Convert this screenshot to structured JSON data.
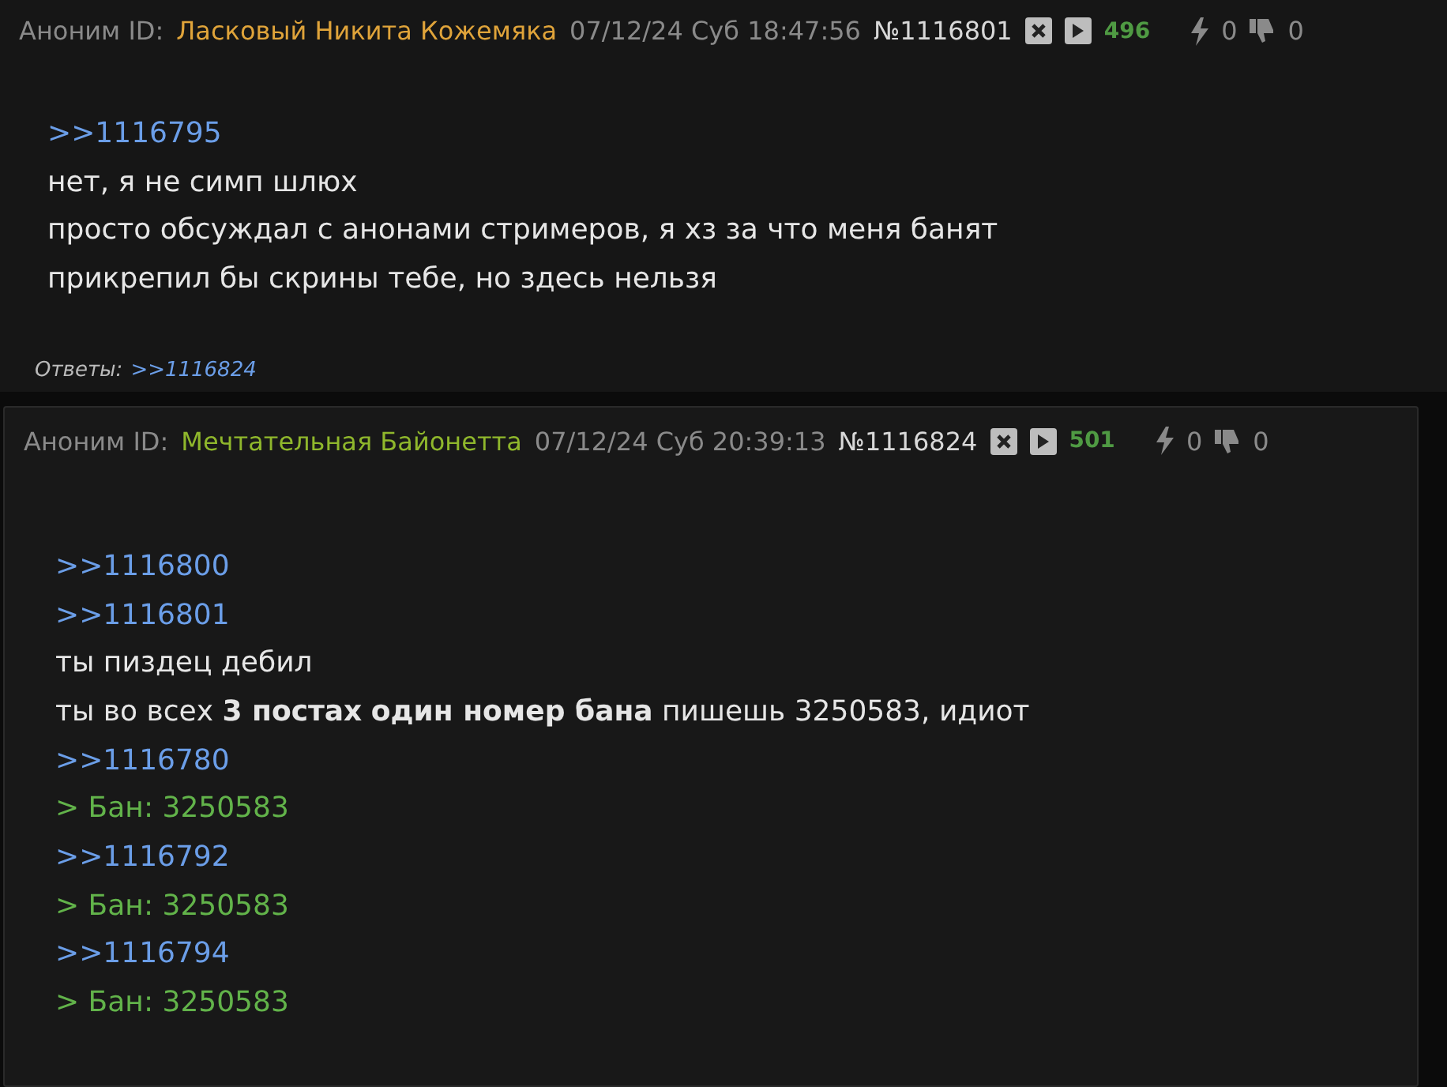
{
  "posts": [
    {
      "author": "Аноним ID:",
      "name": "Ласковый Никита Кожемяка",
      "color": "#e0a43a",
      "date": "07/12/24 Суб 18:47:56",
      "number": "№1116801",
      "count": "496",
      "likes": "0",
      "dislikes": "0",
      "lines": [
        {
          "kind": "reply-link",
          "text": ">>1116795"
        },
        {
          "kind": "text",
          "text": "нет, я не симп шлюх"
        },
        {
          "kind": "text",
          "text": "просто обсуждал с анонами стримеров, я хз за что меня банят"
        },
        {
          "kind": "text",
          "text": "прикрепил бы скрины тебе, но здесь нельзя"
        }
      ],
      "replies_label": "Ответы:",
      "replies": [
        ">>1116824"
      ]
    },
    {
      "author": "Аноним ID:",
      "name": "Мечтательная Байонетта",
      "color": "#8fb72c",
      "date": "07/12/24 Суб 20:39:13",
      "number": "№1116824",
      "count": "501",
      "likes": "0",
      "dislikes": "0",
      "lines": [
        {
          "kind": "reply-link",
          "text": ">>1116800"
        },
        {
          "kind": "reply-link",
          "text": ">>1116801"
        },
        {
          "kind": "text",
          "text": "ты пиздец дебил"
        },
        {
          "kind": "mixed",
          "text": "ты во всех **3 постах** **один номер бана** пишешь 3250583, идиот"
        },
        {
          "kind": "reply-link",
          "text": ">>1116780"
        },
        {
          "kind": "quote",
          "text": "> Бан: 3250583"
        },
        {
          "kind": "reply-link",
          "text": ">>1116792"
        },
        {
          "kind": "quote",
          "text": "> Бан: 3250583"
        },
        {
          "kind": "reply-link",
          "text": ">>1116794"
        },
        {
          "kind": "quote",
          "text": "> Бан: 3250583"
        }
      ]
    }
  ]
}
